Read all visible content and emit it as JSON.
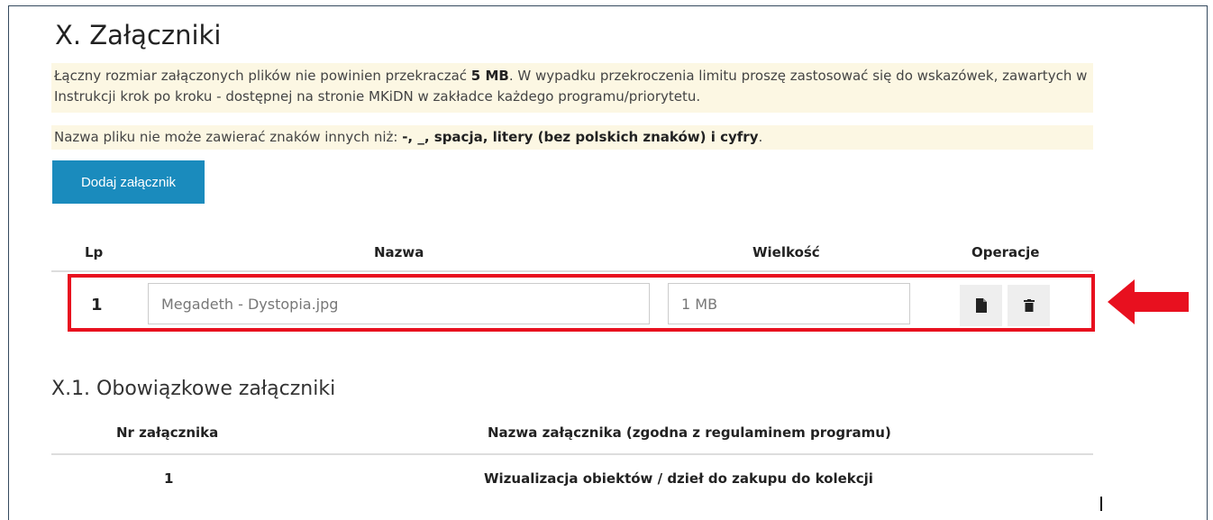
{
  "section": {
    "title": "X. Załączniki",
    "info1_part1": "Łączny rozmiar załączonych plików nie powinien przekraczać ",
    "info1_bold": "5 MB",
    "info1_part2": ". W wypadku przekroczenia limitu proszę zastosować się do wskazówek, zawartych w Instrukcji krok po kroku - dostępnej na stronie MKiDN w zakładce każdego programu/priorytetu.",
    "info2_part1": "Nazwa pliku nie może zawierać znaków innych niż: ",
    "info2_bold": "-, _, spacja, litery (bez polskich znaków) i cyfry",
    "info2_part2": ".",
    "add_button": "Dodaj załącznik"
  },
  "table": {
    "headers": {
      "lp": "Lp",
      "name": "Nazwa",
      "size": "Wielkość",
      "ops": "Operacje"
    },
    "rows": [
      {
        "lp": "1",
        "name": "Megadeth - Dystopia.jpg",
        "size": "1 MB"
      }
    ]
  },
  "icons": {
    "view": "file-icon",
    "delete": "trash-icon",
    "arrow": "left-arrow-icon"
  },
  "colors": {
    "accent": "#1a8bbd",
    "highlight": "#e8101f",
    "info_bg": "#fcf7e3"
  },
  "mandatory": {
    "title": "X.1. Obowiązkowe załączniki",
    "headers": {
      "nr": "Nr załącznika",
      "name": "Nazwa załącznika (zgodna z regulaminem programu)"
    },
    "rows": [
      {
        "nr": "1",
        "name": "Wizualizacja obiektów / dzieł do zakupu do kolekcji"
      }
    ]
  }
}
